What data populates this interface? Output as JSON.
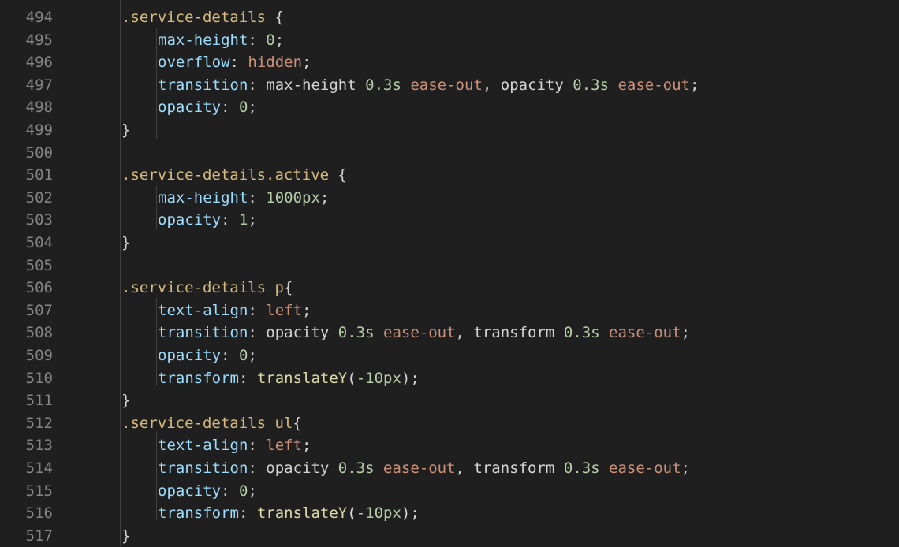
{
  "editor": {
    "theme": {
      "background": "#1f1f1f",
      "line_number": "#858585",
      "selector": "#d7ba7d",
      "property": "#9cdcfe",
      "number": "#b5cea8",
      "keyword": "#ce9178",
      "function": "#dcdcaa",
      "text": "#d4d4d4",
      "indent_guide": "#404040"
    },
    "lines": [
      {
        "number": "494",
        "indent": 1,
        "tokens": [
          {
            "t": "selector",
            "v": ".service-details"
          },
          {
            "t": "punct",
            "v": " {"
          }
        ]
      },
      {
        "number": "495",
        "indent": 2,
        "tokens": [
          {
            "t": "prop",
            "v": "max-height"
          },
          {
            "t": "punct",
            "v": ": "
          },
          {
            "t": "num",
            "v": "0"
          },
          {
            "t": "punct",
            "v": ";"
          }
        ]
      },
      {
        "number": "496",
        "indent": 2,
        "tokens": [
          {
            "t": "prop",
            "v": "overflow"
          },
          {
            "t": "punct",
            "v": ": "
          },
          {
            "t": "kw",
            "v": "hidden"
          },
          {
            "t": "punct",
            "v": ";"
          }
        ]
      },
      {
        "number": "497",
        "indent": 2,
        "tokens": [
          {
            "t": "prop",
            "v": "transition"
          },
          {
            "t": "punct",
            "v": ": "
          },
          {
            "t": "plain",
            "v": "max-height "
          },
          {
            "t": "num",
            "v": "0.3s"
          },
          {
            "t": "plain",
            "v": " "
          },
          {
            "t": "kw",
            "v": "ease-out"
          },
          {
            "t": "punct",
            "v": ", "
          },
          {
            "t": "plain",
            "v": "opacity "
          },
          {
            "t": "num",
            "v": "0.3s"
          },
          {
            "t": "plain",
            "v": " "
          },
          {
            "t": "kw",
            "v": "ease-out"
          },
          {
            "t": "punct",
            "v": ";"
          }
        ]
      },
      {
        "number": "498",
        "indent": 2,
        "tokens": [
          {
            "t": "prop",
            "v": "opacity"
          },
          {
            "t": "punct",
            "v": ": "
          },
          {
            "t": "num",
            "v": "0"
          },
          {
            "t": "punct",
            "v": ";"
          }
        ]
      },
      {
        "number": "499",
        "indent": 1,
        "tokens": [
          {
            "t": "punct",
            "v": "}"
          }
        ]
      },
      {
        "number": "500",
        "indent": 0,
        "tokens": []
      },
      {
        "number": "501",
        "indent": 1,
        "tokens": [
          {
            "t": "selector",
            "v": ".service-details.active"
          },
          {
            "t": "punct",
            "v": " {"
          }
        ]
      },
      {
        "number": "502",
        "indent": 2,
        "tokens": [
          {
            "t": "prop",
            "v": "max-height"
          },
          {
            "t": "punct",
            "v": ": "
          },
          {
            "t": "num",
            "v": "1000px"
          },
          {
            "t": "punct",
            "v": ";"
          }
        ]
      },
      {
        "number": "503",
        "indent": 2,
        "tokens": [
          {
            "t": "prop",
            "v": "opacity"
          },
          {
            "t": "punct",
            "v": ": "
          },
          {
            "t": "num",
            "v": "1"
          },
          {
            "t": "punct",
            "v": ";"
          }
        ]
      },
      {
        "number": "504",
        "indent": 1,
        "tokens": [
          {
            "t": "punct",
            "v": "}"
          }
        ]
      },
      {
        "number": "505",
        "indent": 0,
        "tokens": []
      },
      {
        "number": "506",
        "indent": 1,
        "tokens": [
          {
            "t": "selector",
            "v": ".service-details p"
          },
          {
            "t": "punct",
            "v": "{"
          }
        ]
      },
      {
        "number": "507",
        "indent": 2,
        "tokens": [
          {
            "t": "prop",
            "v": "text-align"
          },
          {
            "t": "punct",
            "v": ": "
          },
          {
            "t": "kw",
            "v": "left"
          },
          {
            "t": "punct",
            "v": ";"
          }
        ]
      },
      {
        "number": "508",
        "indent": 2,
        "tokens": [
          {
            "t": "prop",
            "v": "transition"
          },
          {
            "t": "punct",
            "v": ": "
          },
          {
            "t": "plain",
            "v": "opacity "
          },
          {
            "t": "num",
            "v": "0.3s"
          },
          {
            "t": "plain",
            "v": " "
          },
          {
            "t": "kw",
            "v": "ease-out"
          },
          {
            "t": "punct",
            "v": ", "
          },
          {
            "t": "plain",
            "v": "transform "
          },
          {
            "t": "num",
            "v": "0.3s"
          },
          {
            "t": "plain",
            "v": " "
          },
          {
            "t": "kw",
            "v": "ease-out"
          },
          {
            "t": "punct",
            "v": ";"
          }
        ]
      },
      {
        "number": "509",
        "indent": 2,
        "tokens": [
          {
            "t": "prop",
            "v": "opacity"
          },
          {
            "t": "punct",
            "v": ": "
          },
          {
            "t": "num",
            "v": "0"
          },
          {
            "t": "punct",
            "v": ";"
          }
        ]
      },
      {
        "number": "510",
        "indent": 2,
        "tokens": [
          {
            "t": "prop",
            "v": "transform"
          },
          {
            "t": "punct",
            "v": ": "
          },
          {
            "t": "fn",
            "v": "translateY"
          },
          {
            "t": "punct",
            "v": "("
          },
          {
            "t": "num",
            "v": "-10px"
          },
          {
            "t": "punct",
            "v": ");"
          }
        ]
      },
      {
        "number": "511",
        "indent": 1,
        "tokens": [
          {
            "t": "punct",
            "v": "}"
          }
        ]
      },
      {
        "number": "512",
        "indent": 1,
        "tokens": [
          {
            "t": "selector",
            "v": ".service-details ul"
          },
          {
            "t": "punct",
            "v": "{"
          }
        ]
      },
      {
        "number": "513",
        "indent": 2,
        "tokens": [
          {
            "t": "prop",
            "v": "text-align"
          },
          {
            "t": "punct",
            "v": ": "
          },
          {
            "t": "kw",
            "v": "left"
          },
          {
            "t": "punct",
            "v": ";"
          }
        ]
      },
      {
        "number": "514",
        "indent": 2,
        "tokens": [
          {
            "t": "prop",
            "v": "transition"
          },
          {
            "t": "punct",
            "v": ": "
          },
          {
            "t": "plain",
            "v": "opacity "
          },
          {
            "t": "num",
            "v": "0.3s"
          },
          {
            "t": "plain",
            "v": " "
          },
          {
            "t": "kw",
            "v": "ease-out"
          },
          {
            "t": "punct",
            "v": ", "
          },
          {
            "t": "plain",
            "v": "transform "
          },
          {
            "t": "num",
            "v": "0.3s"
          },
          {
            "t": "plain",
            "v": " "
          },
          {
            "t": "kw",
            "v": "ease-out"
          },
          {
            "t": "punct",
            "v": ";"
          }
        ]
      },
      {
        "number": "515",
        "indent": 2,
        "tokens": [
          {
            "t": "prop",
            "v": "opacity"
          },
          {
            "t": "punct",
            "v": ": "
          },
          {
            "t": "num",
            "v": "0"
          },
          {
            "t": "punct",
            "v": ";"
          }
        ]
      },
      {
        "number": "516",
        "indent": 2,
        "tokens": [
          {
            "t": "prop",
            "v": "transform"
          },
          {
            "t": "punct",
            "v": ": "
          },
          {
            "t": "fn",
            "v": "translateY"
          },
          {
            "t": "punct",
            "v": "("
          },
          {
            "t": "num",
            "v": "-10px"
          },
          {
            "t": "punct",
            "v": ");"
          }
        ]
      },
      {
        "number": "517",
        "indent": 1,
        "tokens": [
          {
            "t": "punct",
            "v": "}"
          }
        ]
      }
    ]
  }
}
